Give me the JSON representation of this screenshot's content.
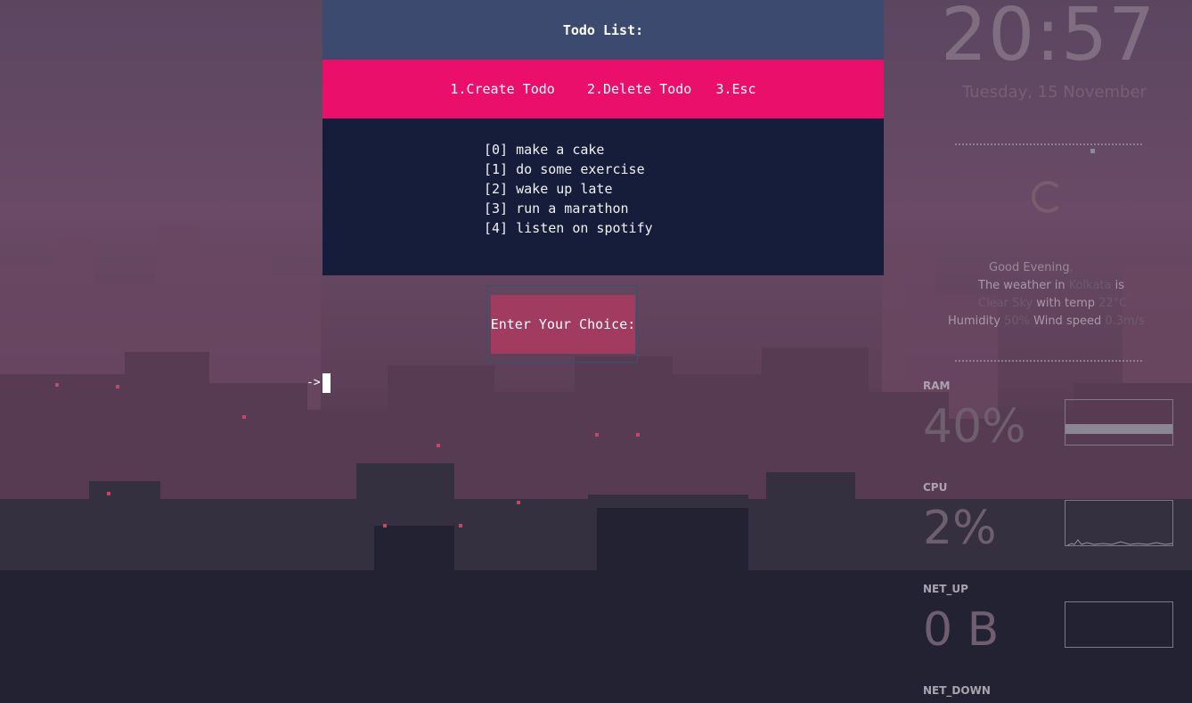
{
  "terminal": {
    "title": "Todo List:",
    "menu": [
      "1.Create Todo",
      "2.Delete Todo",
      "3.Esc"
    ],
    "todos": [
      "[0] make a cake",
      "[1] do some exercise",
      "[2] wake up late",
      "[3] run a marathon",
      "[4] listen on spotify"
    ],
    "prompt_label": "Enter Your Choice:",
    "input_prefix": "->"
  },
  "desktop_widget": {
    "time": "20:57",
    "date": "Tuesday, 15 November",
    "greeting": "Good Evening",
    "greeting_suffix": ",",
    "weather_prefix": "The weather in",
    "weather_location": "Kolkata",
    "weather_is": "is",
    "weather_condition": "Clear Sky",
    "with_temp": "with temp",
    "temperature": "22°C",
    "humidity_label": "Humidity",
    "humidity": "50%",
    "wind_label": "Wind speed",
    "wind": "0.3m/s",
    "ram_label": "RAM",
    "ram_value": "40%",
    "ram_fraction": 0.4,
    "cpu_label": "CPU",
    "cpu_value": "2%",
    "cpu_fraction": 0.02,
    "net_up_label": "NET_UP",
    "net_up_value": "0 B",
    "net_down_label": "NET_DOWN"
  },
  "colors": {
    "header": "#3d4a70",
    "menu": "#e90f6a",
    "list_bg": "#161d3a",
    "prompt": "#a13c60"
  }
}
